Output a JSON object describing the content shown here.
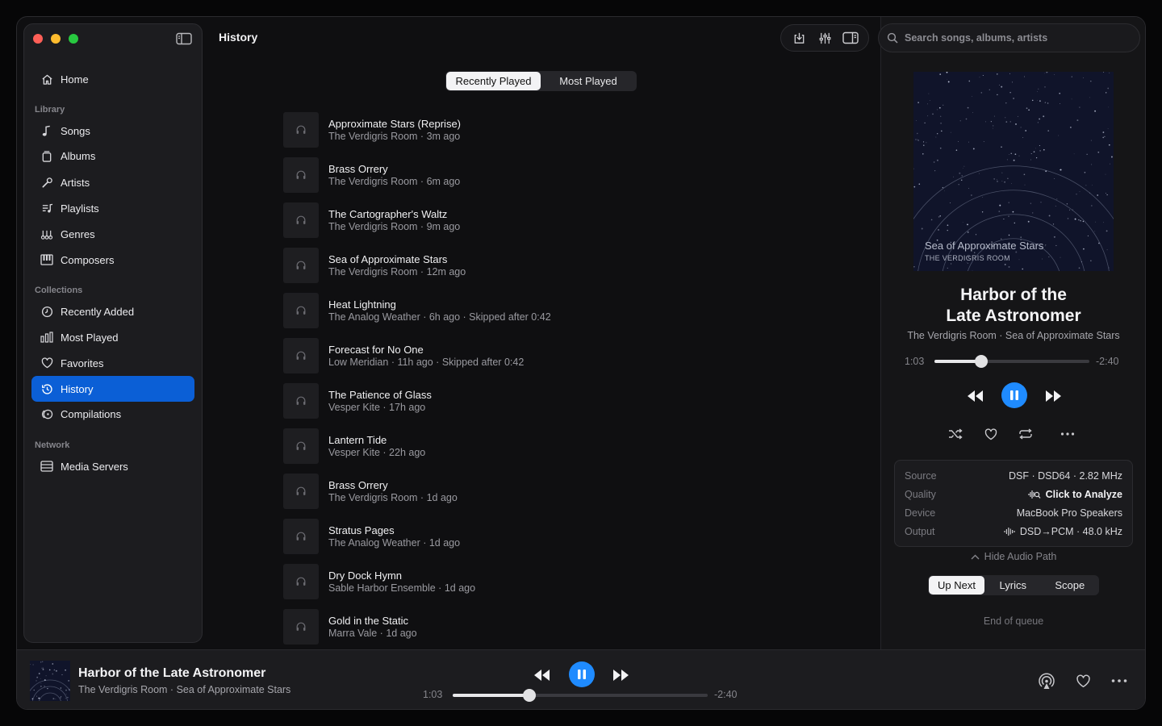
{
  "sidebar": {
    "home_label": "Home",
    "library_heading": "Library",
    "library": [
      "Songs",
      "Albums",
      "Artists",
      "Playlists",
      "Genres",
      "Composers"
    ],
    "collections_heading": "Collections",
    "collections": [
      "Recently Added",
      "Most Played",
      "Favorites",
      "History",
      "Compilations"
    ],
    "network_heading": "Network",
    "network": [
      "Media Servers"
    ],
    "active_item": "History"
  },
  "header": {
    "title": "History"
  },
  "search": {
    "placeholder": "Search songs, albums, artists"
  },
  "tabs": {
    "recently_played": "Recently Played",
    "most_played": "Most Played",
    "selected": "Recently Played"
  },
  "history": [
    {
      "title": "Approximate Stars (Reprise)",
      "subtitle": "The Verdigris Room · 3m ago"
    },
    {
      "title": "Brass Orrery",
      "subtitle": "The Verdigris Room · 6m ago"
    },
    {
      "title": "The Cartographer's Waltz",
      "subtitle": "The Verdigris Room · 9m ago"
    },
    {
      "title": "Sea of Approximate Stars",
      "subtitle": "The Verdigris Room · 12m ago"
    },
    {
      "title": "Heat Lightning",
      "subtitle": "The Analog Weather · 6h ago · Skipped after 0:42"
    },
    {
      "title": "Forecast for No One",
      "subtitle": "Low Meridian · 11h ago · Skipped after 0:42"
    },
    {
      "title": "The Patience of Glass",
      "subtitle": "Vesper Kite · 17h ago"
    },
    {
      "title": "Lantern Tide",
      "subtitle": "Vesper Kite · 22h ago"
    },
    {
      "title": "Brass Orrery",
      "subtitle": "The Verdigris Room · 1d ago"
    },
    {
      "title": "Stratus Pages",
      "subtitle": "The Analog Weather · 1d ago"
    },
    {
      "title": "Dry Dock Hymn",
      "subtitle": "Sable Harbor Ensemble · 1d ago"
    },
    {
      "title": "Gold in the Static",
      "subtitle": "Marra Vale · 1d ago"
    }
  ],
  "now_playing": {
    "art_title": "Sea of Approximate Stars",
    "art_artist": "THE VERDIGRIS ROOM",
    "title_line1": "Harbor of the",
    "title_line2": "Late Astronomer",
    "title_full": "Harbor of the Late Astronomer",
    "subtitle": "The Verdigris Room · Sea of Approximate Stars",
    "elapsed": "1:03",
    "remaining": "-2:40",
    "progress_fraction": 0.3
  },
  "audio_path": {
    "source_label": "Source",
    "source_value": "DSF · DSD64 · 2.82 MHz",
    "quality_label": "Quality",
    "quality_value": "Click to Analyze",
    "device_label": "Device",
    "device_value": "MacBook Pro Speakers",
    "output_label": "Output",
    "output_value": "DSD→PCM · 48.0 kHz",
    "toggle_label": "Hide Audio Path"
  },
  "queue_tabs": {
    "up_next": "Up Next",
    "lyrics": "Lyrics",
    "scope": "Scope",
    "selected": "Up Next"
  },
  "queue": {
    "empty_text": "End of queue"
  },
  "colors": {
    "accent": "#1f8bff",
    "selection": "#0b5fd6"
  }
}
